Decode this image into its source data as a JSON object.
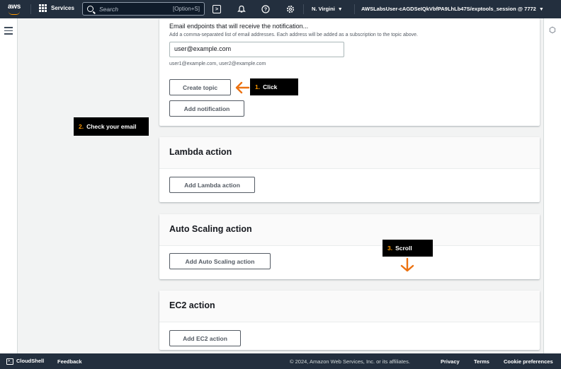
{
  "topnav": {
    "logo_text": "aws",
    "services_label": "Services",
    "search_placeholder": "Search",
    "search_shortcut": "[Option+S]",
    "region": "N. Virgini",
    "account": "AWSLabsUser-cAGDSeIQkVbfPA9LhLb47S/exptools_session @ 7772"
  },
  "topic_panel": {
    "email_label": "Email endpoints that will receive the notification...",
    "email_description": "Add a comma-separated list of email addresses. Each address will be added as a subscription to the topic above.",
    "email_value": "user@example.com",
    "email_hint": "user1@example.com, user2@example.com",
    "create_topic_label": "Create topic",
    "add_notification_label": "Add notification"
  },
  "sections": {
    "lambda": {
      "title": "Lambda action",
      "button": "Add Lambda action"
    },
    "autoscaling": {
      "title": "Auto Scaling action",
      "button": "Add Auto Scaling action"
    },
    "ec2": {
      "title": "EC2 action",
      "button": "Add EC2 action"
    }
  },
  "callouts": {
    "click": {
      "num": "1.",
      "text": "Click"
    },
    "email": {
      "num": "2.",
      "text": "Check your email"
    },
    "scroll": {
      "num": "3.",
      "text": "Scroll"
    }
  },
  "footer": {
    "cloudshell": "CloudShell",
    "feedback": "Feedback",
    "copyright": "© 2024, Amazon Web Services, Inc. or its affiliates.",
    "privacy": "Privacy",
    "terms": "Terms",
    "cookies": "Cookie preferences"
  },
  "colors": {
    "nav_bg": "#232f3e",
    "accent_orange": "#ff9900",
    "callout_arrow": "#ec7211"
  }
}
